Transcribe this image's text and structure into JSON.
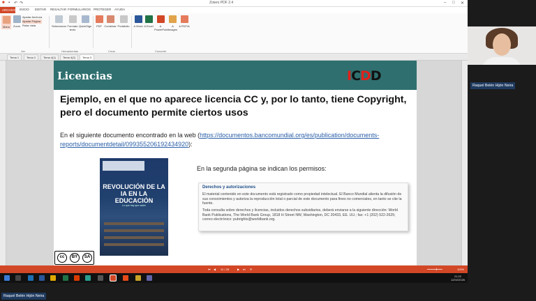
{
  "window": {
    "title": "Zotero PDF 2.4"
  },
  "menu": {
    "file_label": "ARCHIVO",
    "items": [
      "INICIO",
      "EDITAR",
      "RESALTAR",
      "FORMULARIOS",
      "PROTEGER",
      "AYUDA"
    ]
  },
  "ribbon": {
    "buttons": [
      "Mano",
      "Zoom",
      "Seleccionar",
      "Formato texto",
      "QuickSign",
      "PDF",
      "Combinar",
      "Portafolio",
      "A Word",
      "A Excel",
      "A PowerPoint",
      "A Imagen",
      "A PDF/A"
    ],
    "small_items": [
      "Ajustar Anchura",
      "Ajustar Página",
      "Rotar vista"
    ],
    "groups": [
      "Ver",
      "Herramientas",
      "Crear",
      "Convertir"
    ]
  },
  "tabs": [
    "Tema 1",
    "Tema 2",
    "Tema 4(1)",
    "Tema 4(2)",
    "Tema 3"
  ],
  "slide": {
    "title": "Licencias",
    "logo": "ICDD",
    "heading": "Ejemplo, en el que no aparece licencia CC y, por lo tanto, tiene Copyright, pero el documento permite ciertos usos",
    "para_prefix": "En el siguiente documento encontrado en la web (",
    "link": "https://documentos.bancomundial.org/es/publication/documents-reports/documentdetail/099355206192434920",
    "para_suffix": "):",
    "cover_title": "REVOLUCIÓN DE LA IA EN LA EDUCACIÓN",
    "cover_subtitle": "Lo que hay que saber",
    "permission_note": "En la segunda página se indican los permisos:",
    "rights": {
      "title": "Derechos y autorizaciones",
      "p1": "El material contenido en este documento está registrado como propiedad intelectual. El Banco Mundial alienta la difusión de sus conocimientos y autoriza la reproducción total o parcial de este documento para fines no comerciales, en tanto se cite la fuente.",
      "p2": "Toda consulta sobre derechos y licencias, incluidos derechos subsidiarios, deberá enviarse a la siguiente dirección: World Bank Publications, The World Bank Group, 1818 H Street NW, Washington, DC 20433, EE. UU.; fax: +1 (202) 522-2625; correo electrónico: pubrights@worldbank.org."
    },
    "cc": {
      "cc": "cc",
      "by": "BY",
      "sa": "SA"
    }
  },
  "status": {
    "page": "11 / 28",
    "zoom": "113%"
  },
  "clock": {
    "time": "21:22",
    "date": "12/02/2026"
  },
  "participant": "Raquel Belén Hijón Neira"
}
